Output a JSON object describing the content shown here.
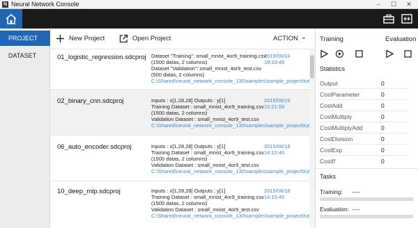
{
  "window": {
    "icon_letter": "N",
    "title": "Neural Network Console"
  },
  "topbar": {
    "icons": [
      "home-icon",
      "toolbox-icon",
      "fit-screen-icon"
    ]
  },
  "nav": {
    "project": "PROJECT",
    "dataset": "DATASET"
  },
  "toolbar": {
    "new_project": "New Project",
    "open_project": "Open Project",
    "action": "ACTION",
    "action_caret": "⌄"
  },
  "projects": [
    {
      "name": "01_logistic_regression.sdcproj",
      "date": "2019/06/24 19:33:49",
      "details": [
        "Dataset \"Training\": small_mnist_4or9_training.csv",
        "(1500 datas, 2 columns)",
        "Dataset \"Validation\": small_mnist_4or9_test.csv",
        "(500 datas, 2 columns)"
      ],
      "path": "C:\\Shared\\neural_network_console_130\\samples\\sample_project\\tutorial\\"
    },
    {
      "name": "02_binary_cnn.sdcproj",
      "date": "2015/06/19 10:21:59",
      "details": [
        "Inputs : x[1,28,28]     Outputs : y[1]",
        "Training Dataset : small_mnist_4or9_training.csv",
        "(1500 datas, 2 columns)",
        "Validation Dataset : small_mnist_4or9_test.csv"
      ],
      "path": "C:\\Shared\\neural_network_console_130\\samples\\sample_project\\tutorial\\"
    },
    {
      "name": "06_auto_encoder.sdcproj",
      "date": "2015/06/18 14:15:40",
      "details": [
        "Inputs : x[1,28,28]     Outputs : y[1]",
        "Training Dataset : small_mnist_4or9_training.csv",
        "(1500 datas, 2 columns)",
        "Validation Dataset : small_mnist_4or9_test.csv"
      ],
      "path": "C:\\Shared\\neural_network_console_130\\samples\\sample_project\\tutorial\\"
    },
    {
      "name": "10_deep_mlp.sdcproj",
      "date": "2015/06/18 14:15:45",
      "details": [
        "Inputs : x[1,28,28]     Outputs : y[1]",
        "Training Dataset : small_mnist_4or9_training.csv",
        "(1500 datas, 2 columns)",
        "Validation Dataset : small_mnist_4or9_test.csv"
      ],
      "path": "C:\\Shared\\neural_network_console_130\\samples\\sample_project\\tutorial\\"
    }
  ],
  "right_panel": {
    "training": "Training",
    "evaluation": "Evaluation",
    "statistics": "Statistics",
    "stats": [
      {
        "label": "Output",
        "value": "0"
      },
      {
        "label": "CostParameter",
        "value": "0"
      },
      {
        "label": "CostAdd",
        "value": "0"
      },
      {
        "label": "CostMultiply",
        "value": "0"
      },
      {
        "label": "CostMultiplyAdd",
        "value": "0"
      },
      {
        "label": "CostDivision",
        "value": "0"
      },
      {
        "label": "CostExp",
        "value": "0"
      },
      {
        "label": "CostIf",
        "value": "0"
      }
    ],
    "tasks": "Tasks",
    "training_label": "Training:",
    "training_value": "----",
    "evaluation_label": "Evaluation:",
    "evaluation_value": "----"
  },
  "colors": {
    "accent": "#1f66b4",
    "topbar": "#1a1a1a",
    "link": "#3a8ad6"
  }
}
